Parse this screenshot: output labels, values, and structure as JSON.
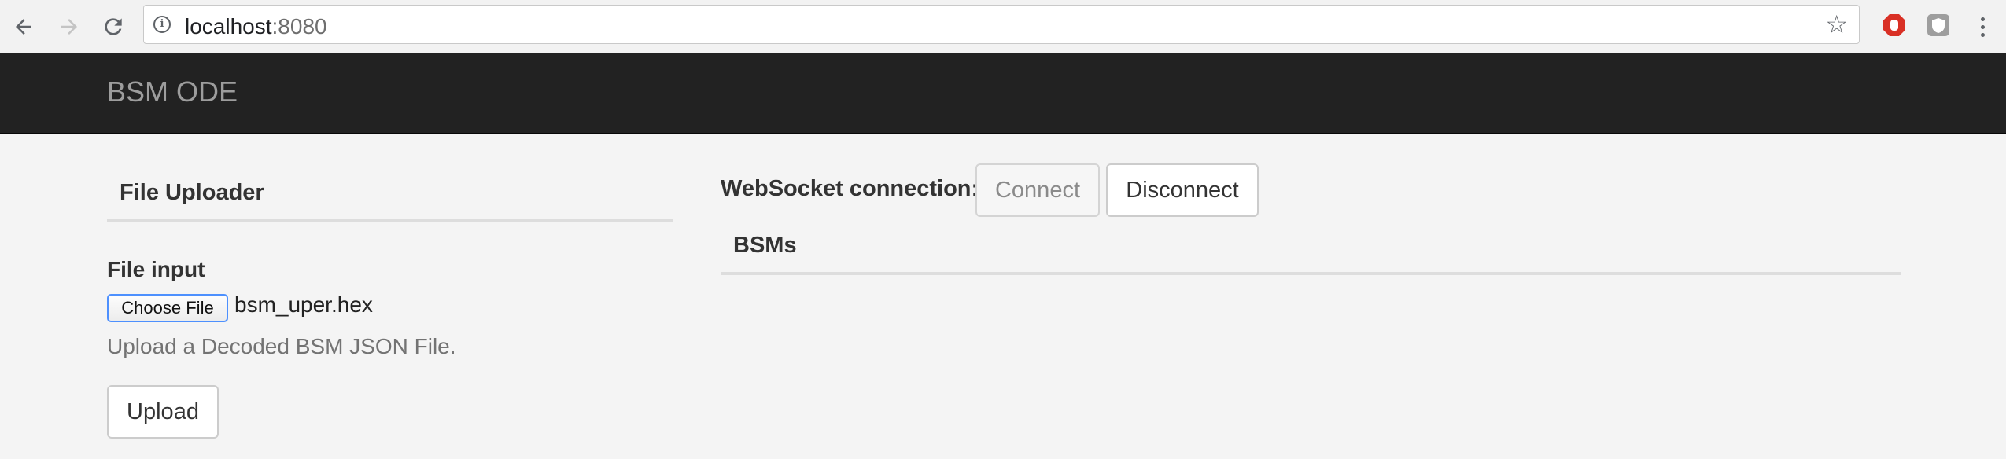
{
  "browser": {
    "url_host": "localhost",
    "url_port": ":8080"
  },
  "navbar": {
    "brand": "BSM ODE"
  },
  "uploader": {
    "title": "File Uploader",
    "file_input_label": "File input",
    "choose_file_label": "Choose File",
    "selected_file": "bsm_uper.hex",
    "help_text": "Upload a Decoded BSM JSON File.",
    "upload_label": "Upload"
  },
  "websocket": {
    "label": "WebSocket connection:",
    "connect_label": "Connect",
    "disconnect_label": "Disconnect"
  },
  "bsms": {
    "title": "BSMs"
  },
  "colors": {
    "navbar_bg": "#222222",
    "brand_text": "#9d9d9d",
    "page_bg": "#f4f4f4"
  }
}
